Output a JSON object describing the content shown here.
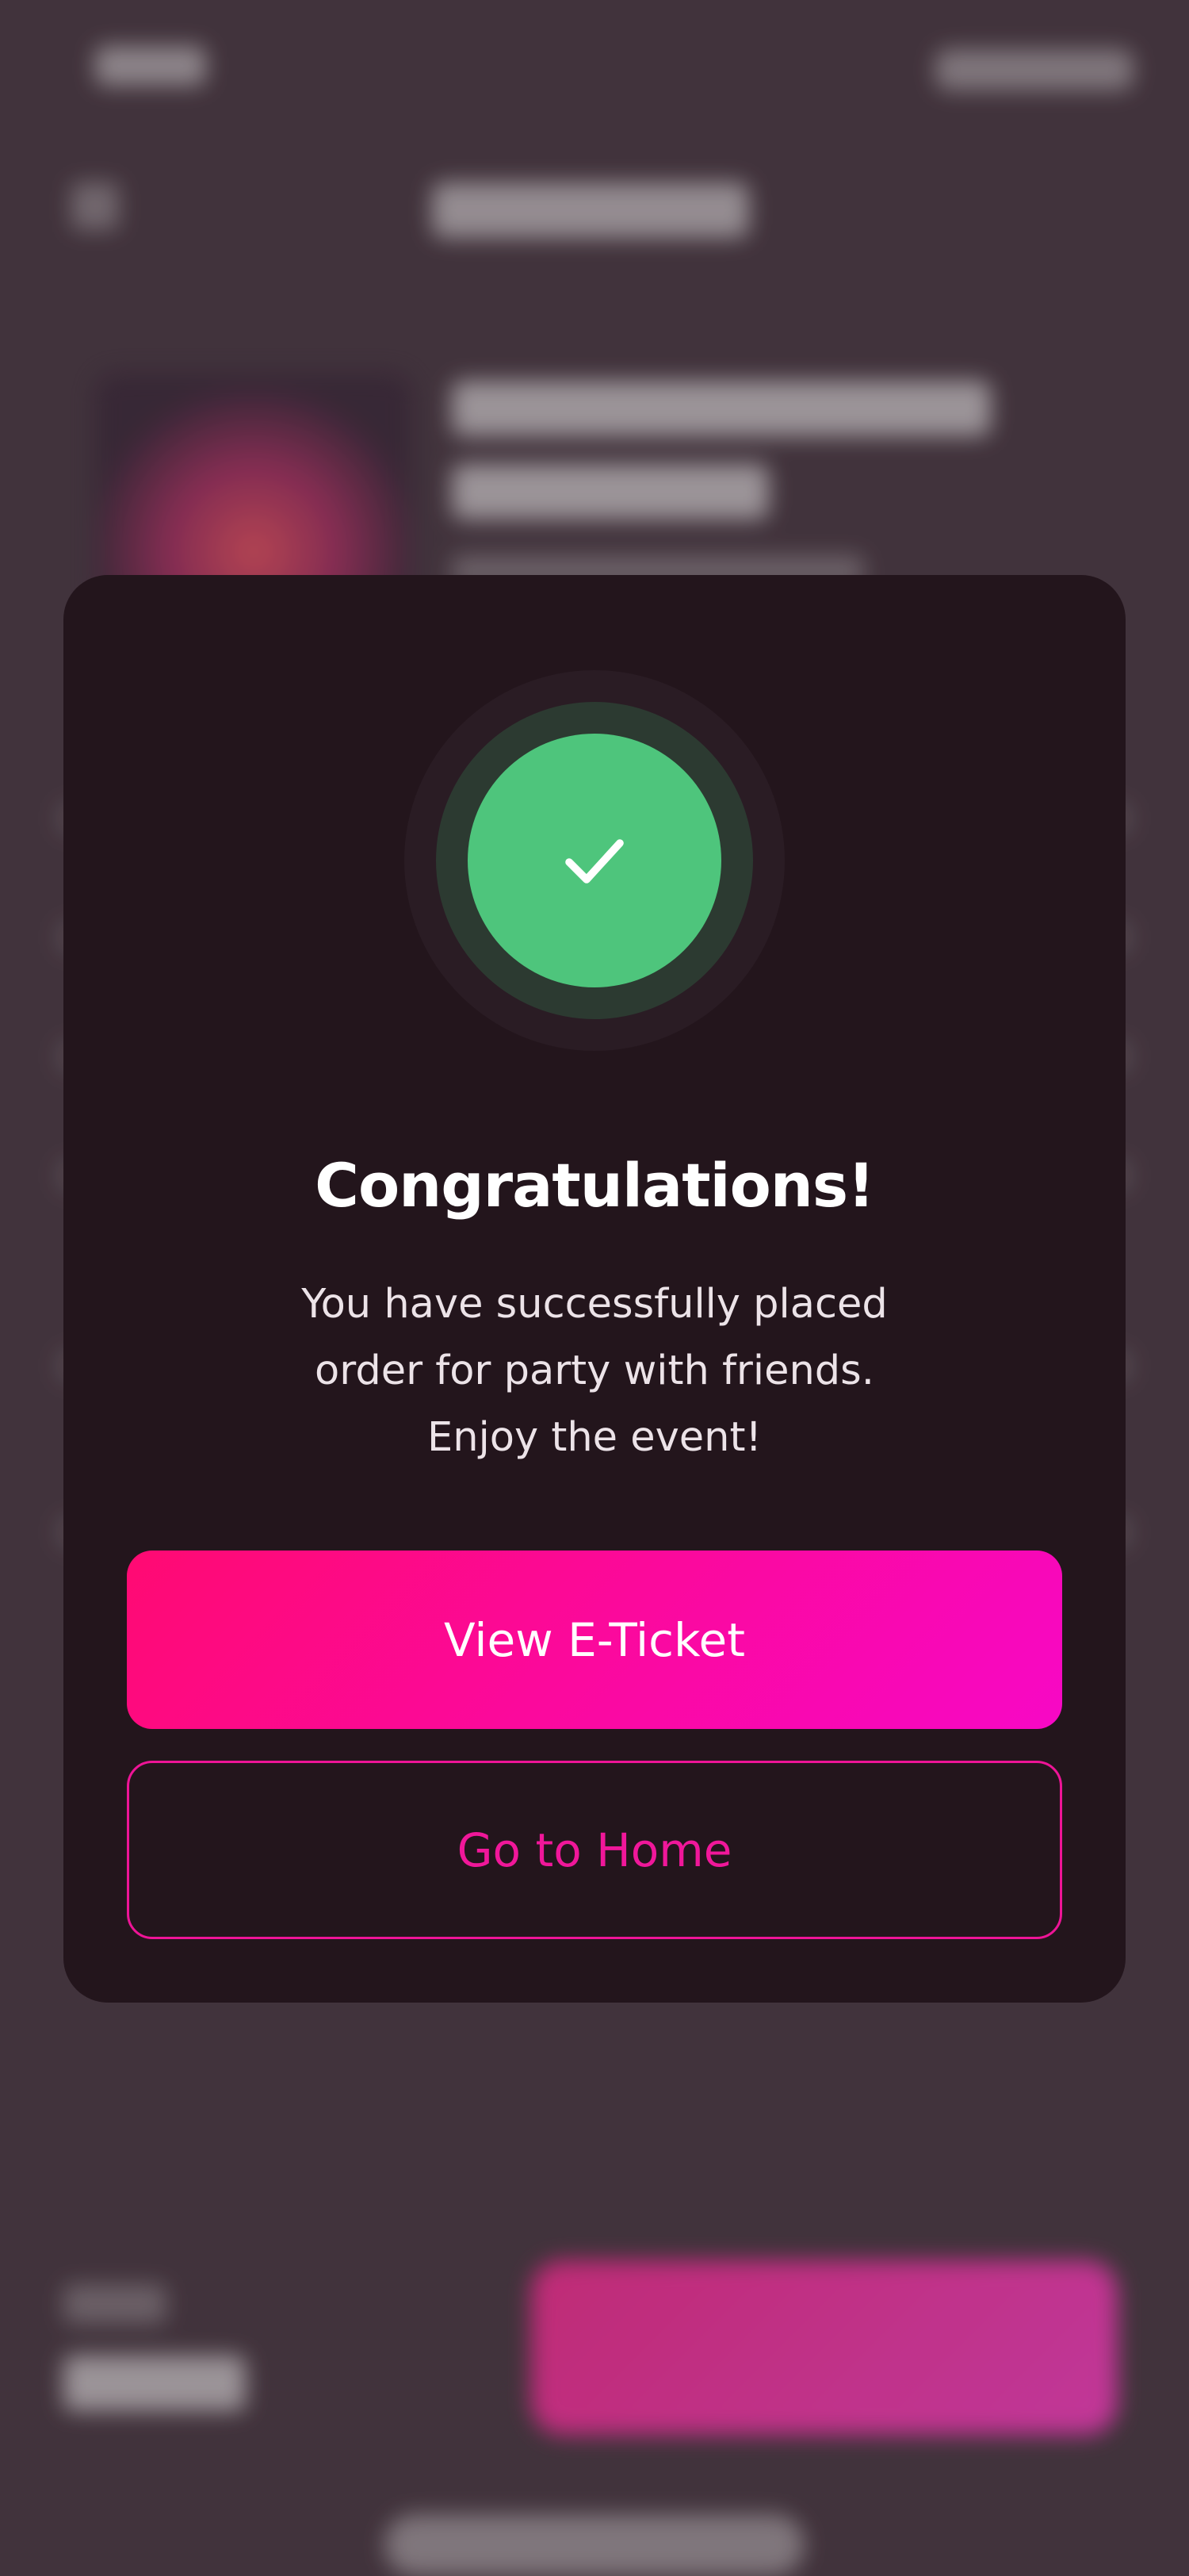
{
  "modal": {
    "title": "Congratulations!",
    "message": "You have successfully placed\norder for party with friends.\nEnjoy the event!",
    "primary_button_label": "View E-Ticket",
    "secondary_button_label": "Go to Home"
  },
  "icons": {
    "success": "check-icon"
  },
  "colors": {
    "success_green": "#4ec57c",
    "accent_pink": "#ff0a72",
    "accent_magenta": "#f708c6",
    "modal_background": "#23151c",
    "screen_background": "#463841"
  }
}
